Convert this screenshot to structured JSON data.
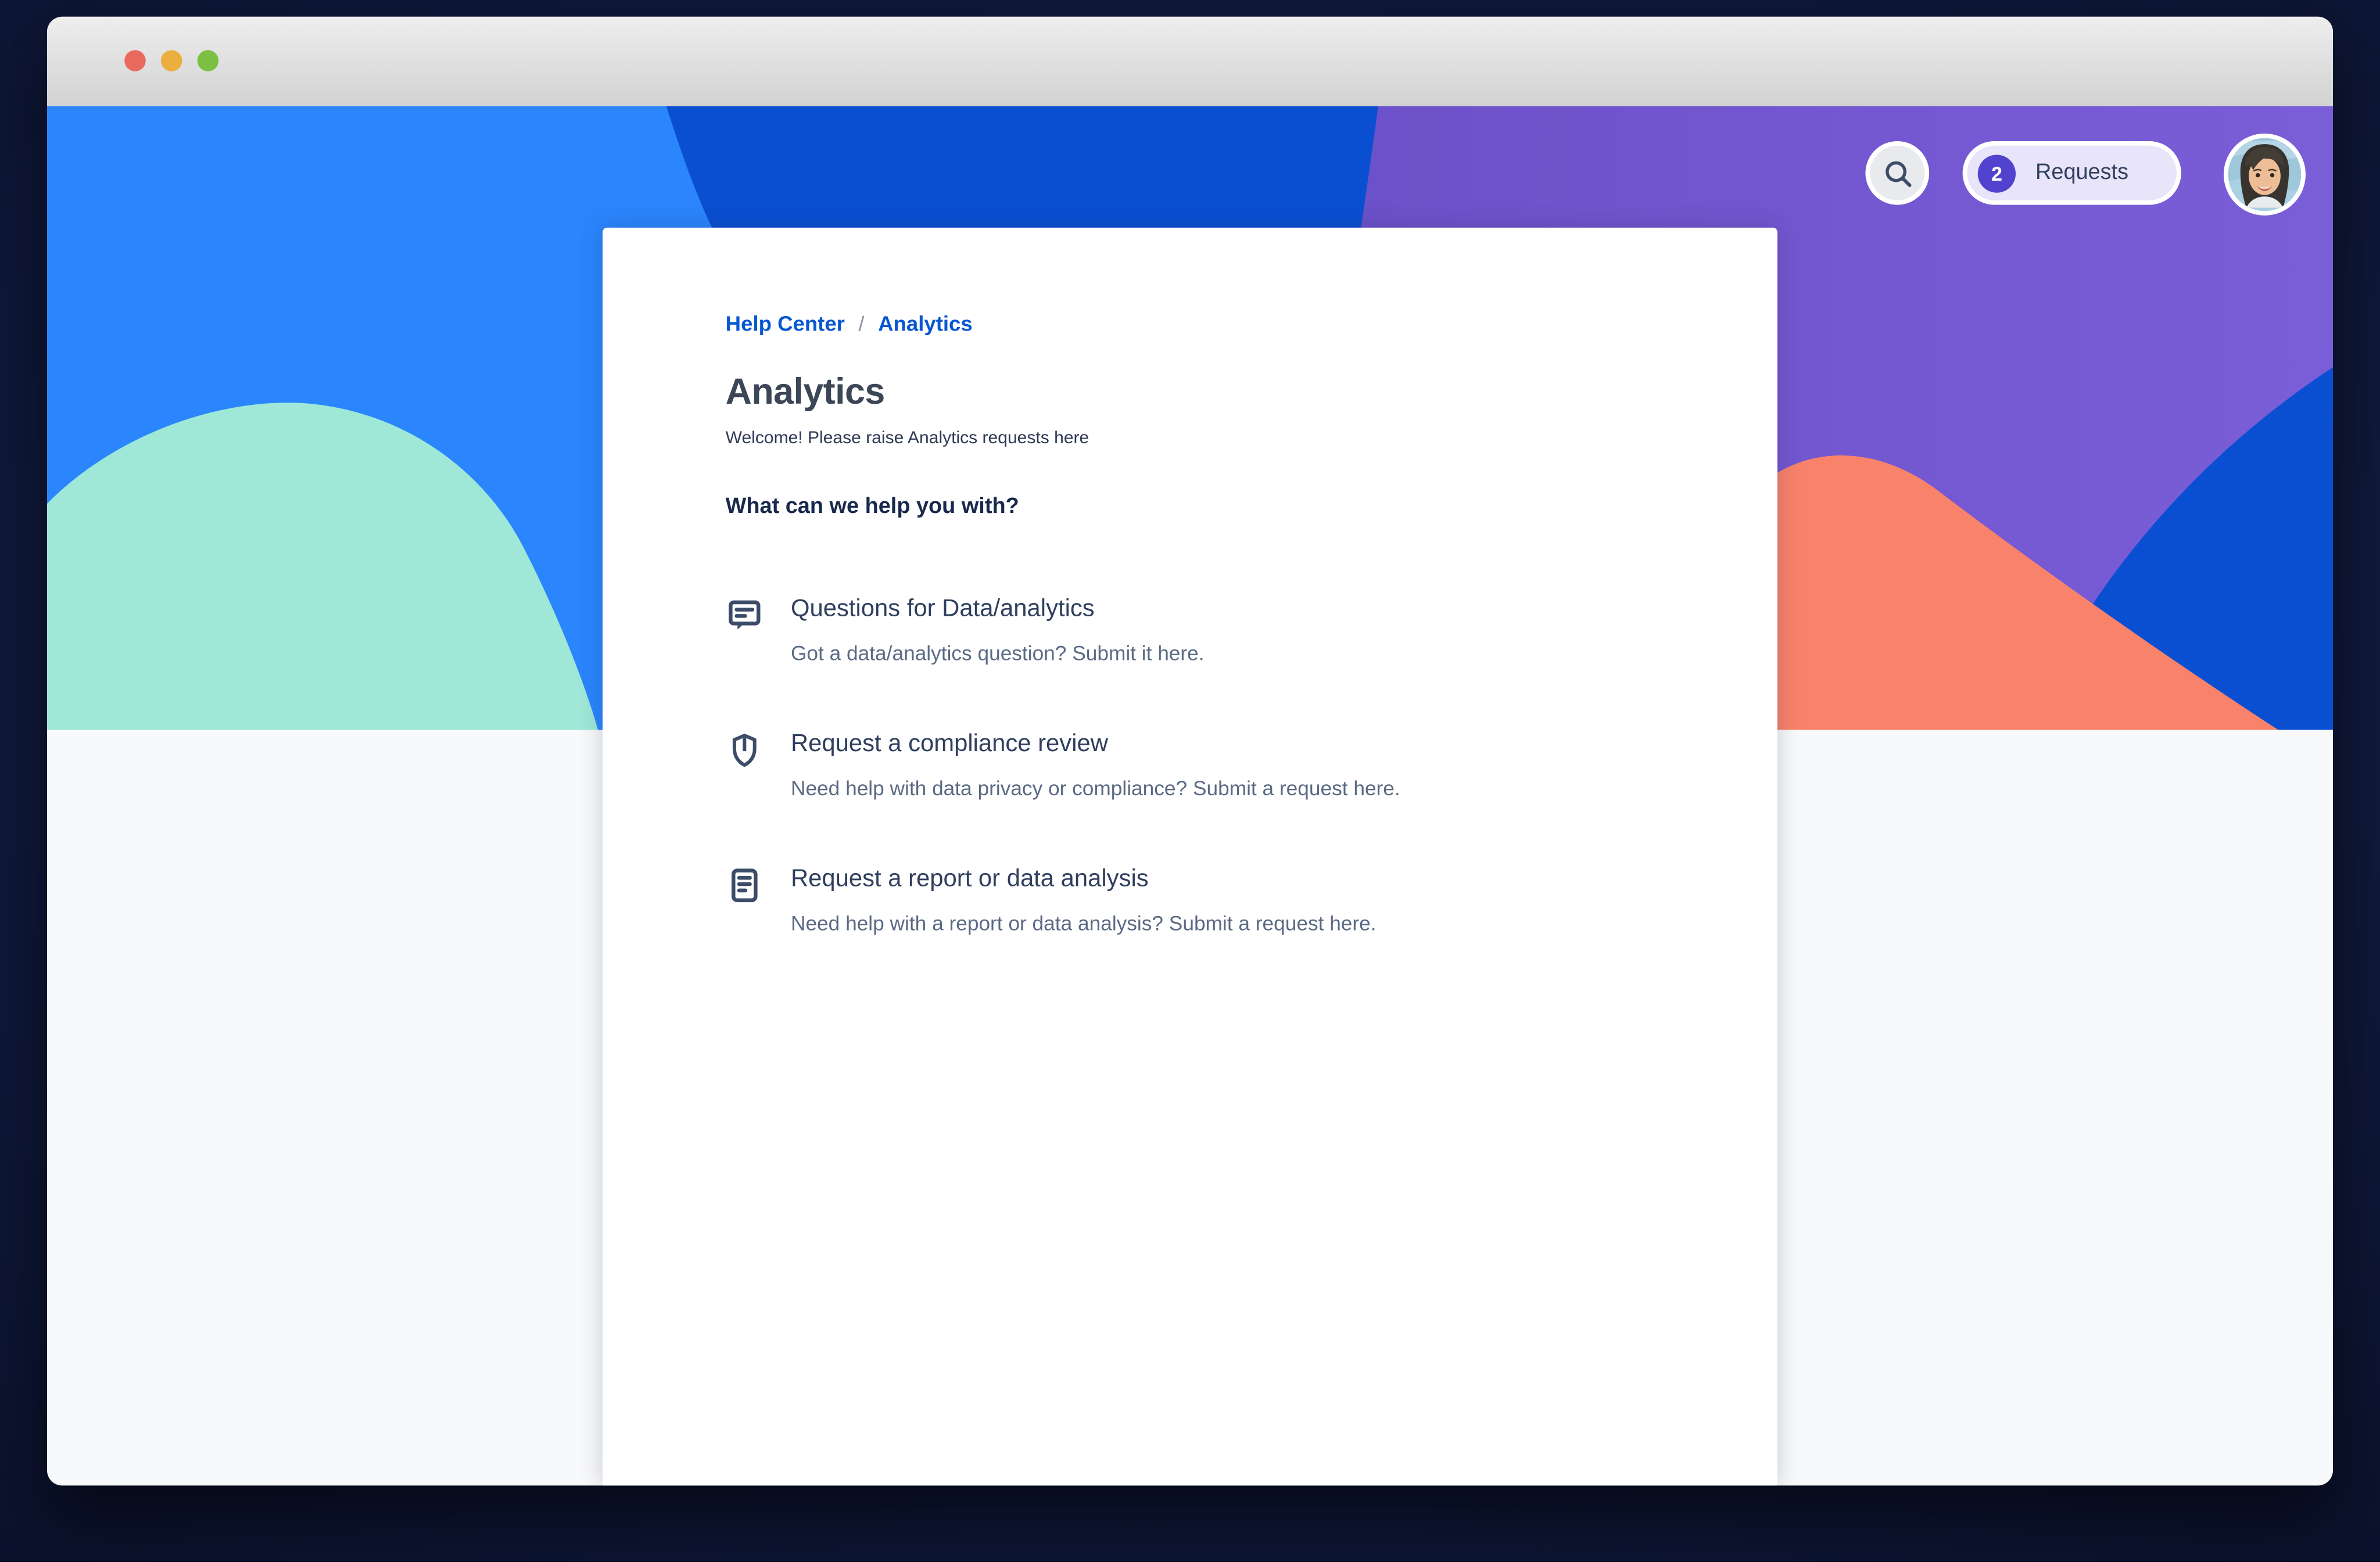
{
  "window": {
    "controls": [
      {
        "name": "close",
        "color": "#e9695c"
      },
      {
        "name": "minimize",
        "color": "#eaaf3d"
      },
      {
        "name": "zoom",
        "color": "#7cc043"
      }
    ]
  },
  "header": {
    "search_icon": "search-icon",
    "requests_button": {
      "count": "2",
      "label": "Requests"
    },
    "avatar_icon": "user-avatar-photo"
  },
  "breadcrumb": {
    "items": [
      {
        "label": "Help Center"
      },
      {
        "label": "Analytics"
      }
    ],
    "separator": "/"
  },
  "card": {
    "title": "Analytics",
    "subtitle": "Welcome! Please raise Analytics requests here",
    "section_heading": "What can we help you with?",
    "items": [
      {
        "icon": "comment-icon",
        "title": "Questions for Data/analytics",
        "description": "Got a data/analytics question? Submit it here."
      },
      {
        "icon": "shield-icon",
        "title": "Request a compliance review",
        "description": "Need help with data privacy or compliance? Submit a request here."
      },
      {
        "icon": "document-icon",
        "title": "Request a report or data analysis",
        "description": "Need help with a report or data analysis? Submit a request here."
      }
    ]
  },
  "colors": {
    "link_blue": "#0757d2",
    "badge_purple": "#5243cf",
    "heading_navy": "#18294c",
    "body_slate": "#5a6a84",
    "banner": {
      "royal_blue": "#0a4fd2",
      "light_blue": "#2b85fc",
      "purple": "#6b50c8",
      "purple_light": "#7a5ed8",
      "mint": "#9fe8d8",
      "coral": "#f9836a"
    }
  }
}
